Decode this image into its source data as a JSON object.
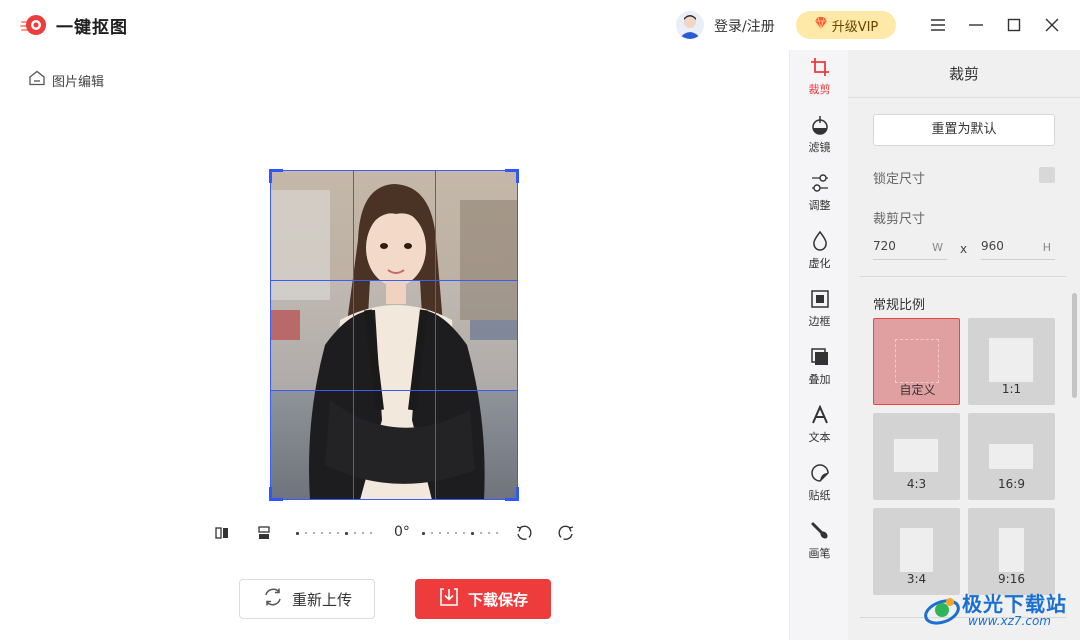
{
  "app": {
    "name": "一键抠图",
    "brand_color": "#ee3b3b"
  },
  "header": {
    "login_label": "登录/注册",
    "vip_label": "升级VIP",
    "window_controls": [
      "menu-icon",
      "minimize-icon",
      "maximize-icon",
      "close-icon"
    ]
  },
  "breadcrumb": {
    "label": "图片编辑",
    "icon": "home-icon"
  },
  "canvas": {
    "image": "portrait-photo",
    "crop_grid": "3x3",
    "accent_color": "#2f56ff"
  },
  "rotate_bar": {
    "angle": "0°",
    "tools": [
      "flip-horizontal-icon",
      "flip-vertical-icon",
      "rotate-left-icon",
      "rotate-right-icon"
    ]
  },
  "actions": {
    "reupload_label": "重新上传",
    "download_label": "下载保存"
  },
  "rail": {
    "items": [
      {
        "label": "裁剪",
        "icon": "crop-icon",
        "active": true
      },
      {
        "label": "滤镜",
        "icon": "filter-icon"
      },
      {
        "label": "调整",
        "icon": "adjust-icon"
      },
      {
        "label": "虚化",
        "icon": "blur-icon"
      },
      {
        "label": "边框",
        "icon": "border-icon"
      },
      {
        "label": "叠加",
        "icon": "overlay-icon"
      },
      {
        "label": "文本",
        "icon": "text-icon"
      },
      {
        "label": "贴纸",
        "icon": "sticker-icon"
      },
      {
        "label": "画笔",
        "icon": "brush-icon"
      }
    ]
  },
  "panel": {
    "title": "裁剪",
    "reset_label": "重置为默认",
    "lock_label": "锁定尺寸",
    "lock_checked": false,
    "size_label": "裁剪尺寸",
    "width_value": "720",
    "width_unit": "W",
    "separator": "x",
    "height_value": "960",
    "height_unit": "H",
    "ratio_title": "常规比例",
    "ratios": [
      {
        "label": "自定义",
        "active": true
      },
      {
        "label": "1:1"
      },
      {
        "label": "4:3"
      },
      {
        "label": "16:9"
      },
      {
        "label": "3:4"
      },
      {
        "label": "9:16"
      }
    ]
  },
  "watermark": {
    "text": "极光下载站",
    "url": "www.xz7.com"
  }
}
